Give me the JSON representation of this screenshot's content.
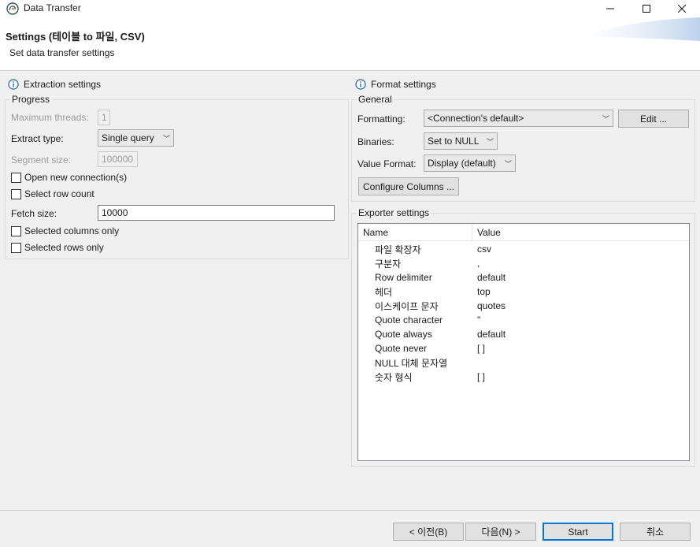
{
  "window": {
    "title": "Data Transfer",
    "controls": {
      "minimize": "—",
      "maximize": "☐",
      "close": "✕"
    }
  },
  "header": {
    "title": "Settings (테이블 to 파일, CSV)",
    "subtitle": "Set data transfer settings"
  },
  "extraction": {
    "section_title": "Extraction settings",
    "progress_group": "Progress",
    "max_threads_label": "Maximum threads:",
    "max_threads_value": "1",
    "extract_type_label": "Extract type:",
    "extract_type_value": "Single query",
    "segment_size_label": "Segment size:",
    "segment_size_value": "100000",
    "open_new_connection": "Open new connection(s)",
    "select_row_count": "Select row count",
    "fetch_size_label": "Fetch size:",
    "fetch_size_value": "10000",
    "selected_columns_only": "Selected columns only",
    "selected_rows_only": "Selected rows only"
  },
  "format": {
    "section_title": "Format settings",
    "general_group": "General",
    "formatting_label": "Formatting:",
    "formatting_value": "<Connection's default>",
    "edit_button": "Edit ...",
    "binaries_label": "Binaries:",
    "binaries_value": "Set to NULL",
    "value_format_label": "Value Format:",
    "value_format_value": "Display (default)",
    "configure_columns_button": "Configure Columns ..."
  },
  "exporter": {
    "group_label": "Exporter settings",
    "columns": [
      "Name",
      "Value"
    ],
    "rows": [
      {
        "name": "파일 확장자",
        "value": "csv"
      },
      {
        "name": "구분자",
        "value": ","
      },
      {
        "name": "Row delimiter",
        "value": "default"
      },
      {
        "name": "헤더",
        "value": "top"
      },
      {
        "name": "이스케이프 문자",
        "value": "quotes"
      },
      {
        "name": "Quote character",
        "value": "\""
      },
      {
        "name": "Quote always",
        "value": "default"
      },
      {
        "name": "Quote never",
        "value": "[ ]"
      },
      {
        "name": "NULL 대체 문자열",
        "value": ""
      },
      {
        "name": "숫자 형식",
        "value": "[ ]"
      }
    ]
  },
  "footer": {
    "back_button": "< 이전(B)",
    "next_button": "다음(N) >",
    "start_button": "Start",
    "cancel_button": "취소"
  },
  "colors": {
    "accent": "#0078d7",
    "info_icon": "#1f5fa8"
  }
}
